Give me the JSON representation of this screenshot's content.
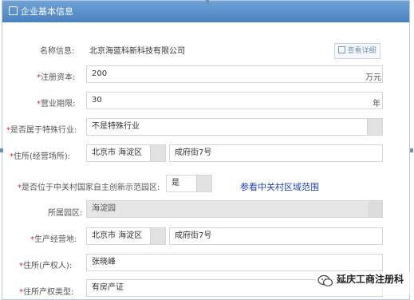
{
  "header": {
    "title": "企业基本信息"
  },
  "buttons": {
    "view_detail": "查看详细"
  },
  "form": {
    "name_label": "名称信息:",
    "name_value": "北京海蓝科新科技有限公司",
    "capital_label": "注册资本:",
    "capital_value": "200",
    "capital_unit": "万元",
    "term_label": "营业期限:",
    "term_value": "30",
    "term_unit": "年",
    "special_label": "是否属于特殊行业:",
    "special_value": "不是特殊行业",
    "residence_label": "住所(经营场所):",
    "residence_city": "北京市  海淀区",
    "residence_street": "成府街7号",
    "zgc_label": "是否位于中关村国家自主创新示范园区:",
    "zgc_value": "是",
    "zgc_link": "参看中关村区域范围",
    "park_label": "所属园区:",
    "park_value": "海淀园",
    "biz_label": "生产经营地:",
    "biz_city": "北京市  海淀区",
    "biz_street": "成府街7号",
    "owner_label": "住所(产权人):",
    "owner_value": "张晓峰",
    "proptype_label": "住所产权类型:",
    "proptype_value": "有房产证",
    "required_mark": "*"
  },
  "watermark": {
    "text": "延庆工商注册科"
  }
}
